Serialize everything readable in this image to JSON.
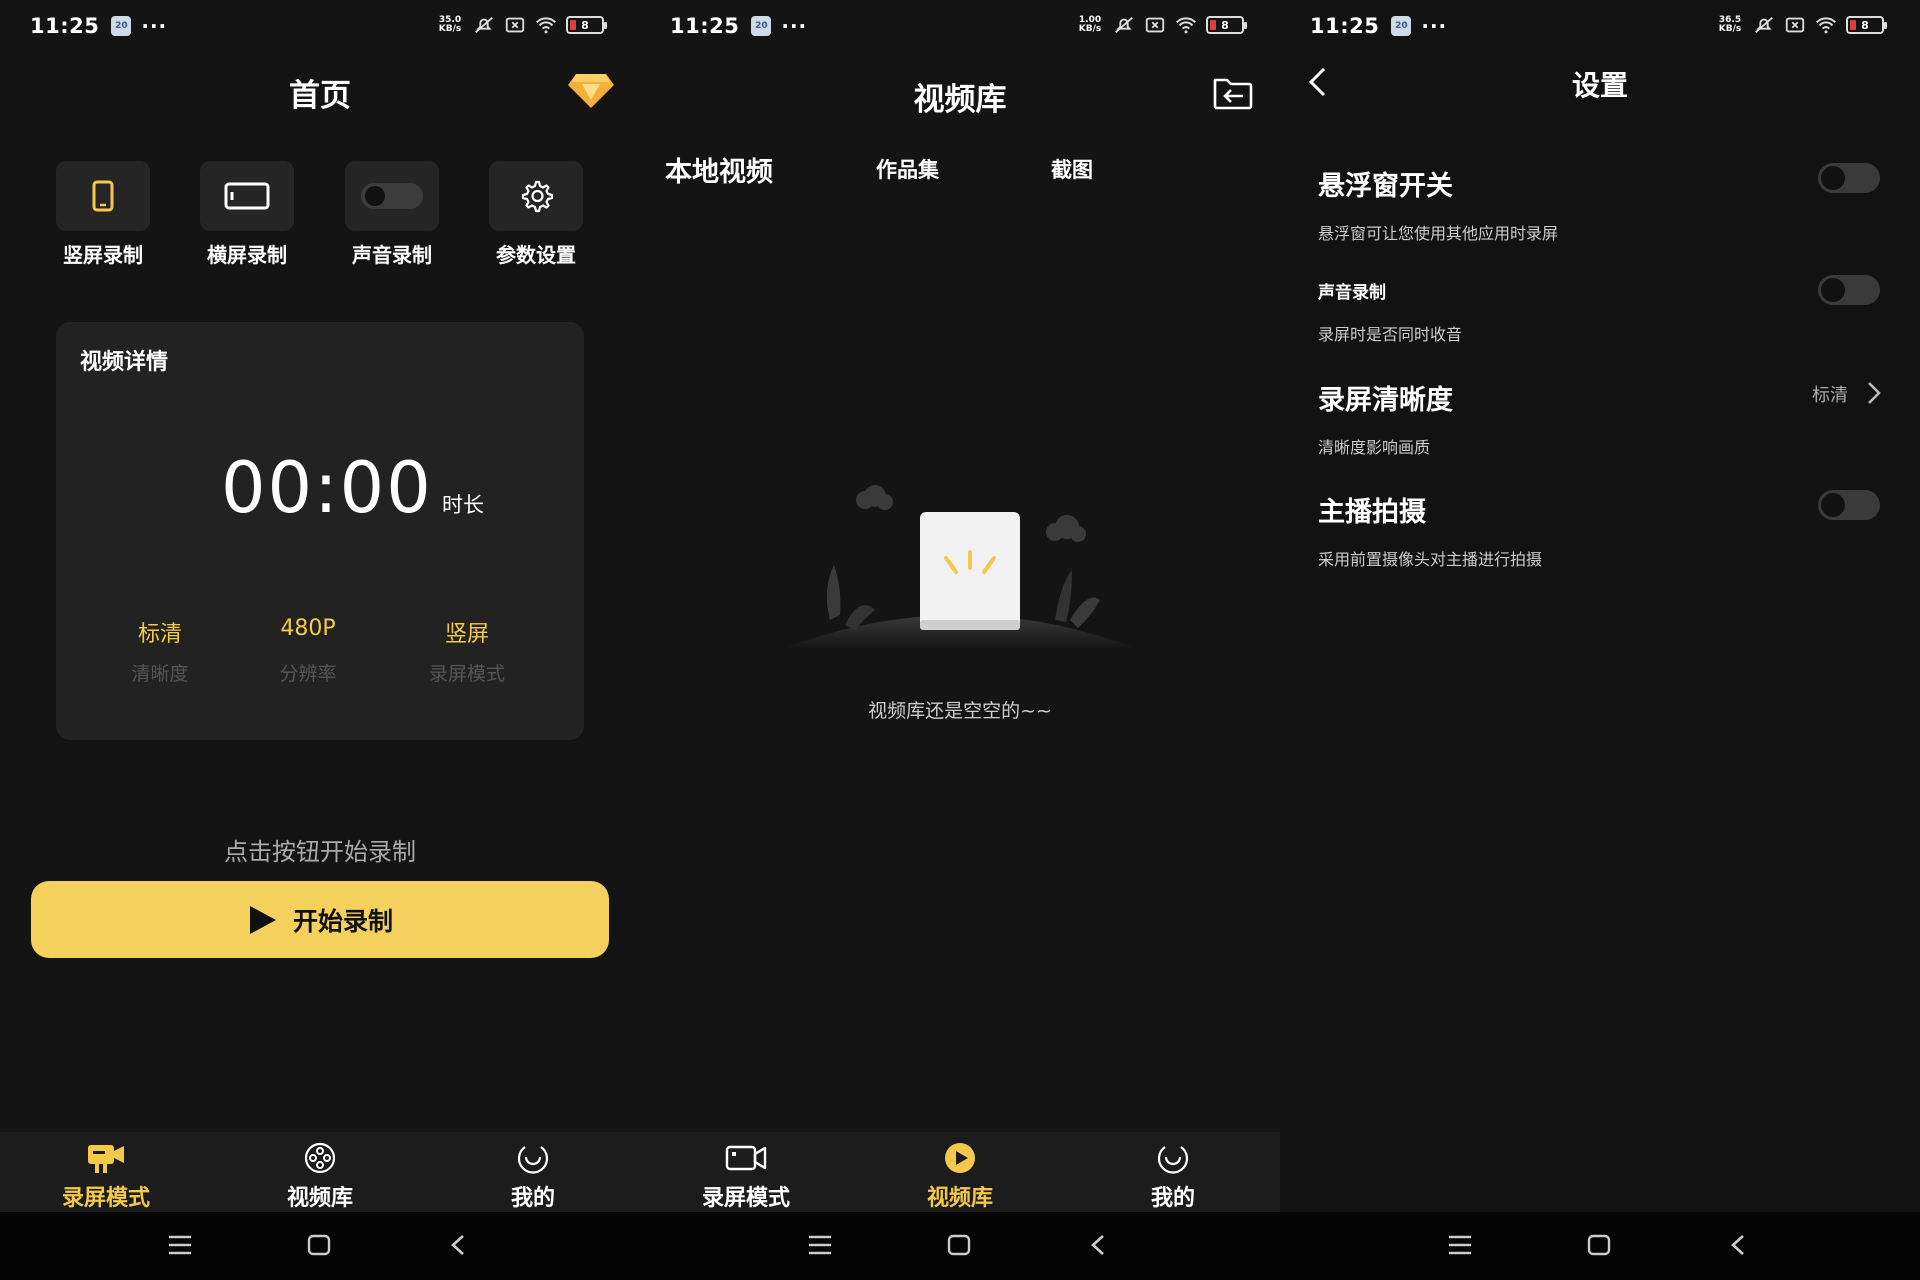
{
  "status_bar": [
    {
      "time": "11:25",
      "badge": "20",
      "dots": "···",
      "speed_top": "35.0",
      "speed_bottom": "KB/s",
      "battery": "8"
    },
    {
      "time": "11:25",
      "badge": "20",
      "dots": "···",
      "speed_top": "1.00",
      "speed_bottom": "KB/s",
      "battery": "8"
    },
    {
      "time": "11:25",
      "badge": "20",
      "dots": "···",
      "speed_top": "36.5",
      "speed_bottom": "KB/s",
      "battery": "8"
    }
  ],
  "home": {
    "title": "首页",
    "quick_actions": [
      {
        "label": "竖屏录制",
        "icon": "portrait-phone-icon"
      },
      {
        "label": "横屏录制",
        "icon": "landscape-phone-icon"
      },
      {
        "label": "声音录制",
        "icon": "toggle-off-icon"
      },
      {
        "label": "参数设置",
        "icon": "gear-icon"
      }
    ],
    "card": {
      "title": "视频详情",
      "timer": "00:00",
      "timer_unit": "时长",
      "stats": [
        {
          "value": "标清",
          "label": "清晰度"
        },
        {
          "value": "480P",
          "label": "分辨率"
        },
        {
          "value": "竖屏",
          "label": "录屏模式"
        }
      ]
    },
    "hint": "点击按钮开始录制",
    "start_label": "开始录制",
    "accent": "#f4d15c"
  },
  "library": {
    "title": "视频库",
    "tabs": [
      "本地视频",
      "作品集",
      "截图"
    ],
    "empty_text": "视频库还是空空的~~"
  },
  "settings": {
    "title": "设置",
    "items": [
      {
        "title": "悬浮窗开关",
        "desc": "悬浮窗可让您使用其他应用时录屏",
        "type": "toggle"
      },
      {
        "title": "声音录制",
        "desc": "录屏时是否同时收音",
        "type": "toggle"
      },
      {
        "title": "录屏清晰度",
        "desc": "清晰度影响画质",
        "type": "value",
        "value": "标清"
      },
      {
        "title": "主播拍摄",
        "desc": "采用前置摄像头对主播进行拍摄",
        "type": "toggle"
      }
    ]
  },
  "nav": {
    "items": [
      "录屏模式",
      "视频库",
      "我的"
    ]
  }
}
